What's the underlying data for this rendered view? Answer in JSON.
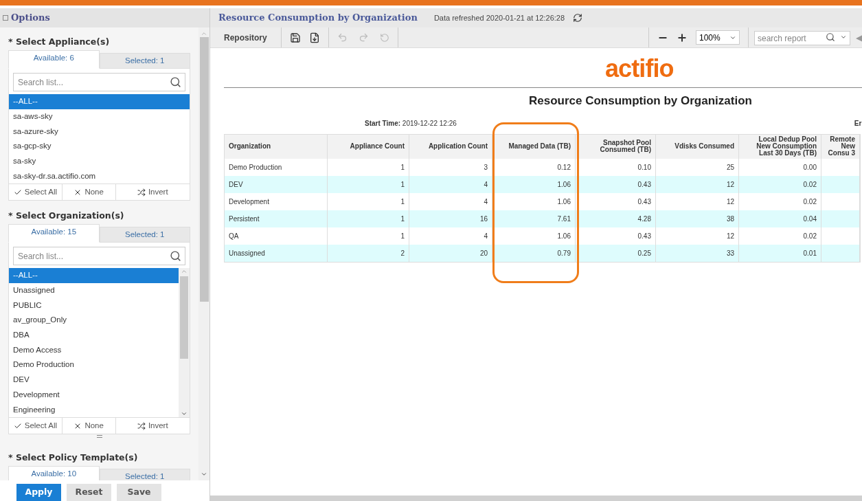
{
  "options_panel": {
    "title": "Options",
    "sections": [
      {
        "label": "* Select Appliance(s)",
        "tabs": [
          {
            "label": "Available: 6",
            "selected": true
          },
          {
            "label": "Selected: 1",
            "selected": false
          }
        ],
        "search_placeholder": "Search list...",
        "scrollable": false,
        "items": [
          {
            "label": "--ALL--",
            "selected": true
          },
          {
            "label": "sa-aws-sky",
            "selected": false
          },
          {
            "label": "sa-azure-sky",
            "selected": false
          },
          {
            "label": "sa-gcp-sky",
            "selected": false
          },
          {
            "label": "sa-sky",
            "selected": false
          },
          {
            "label": "sa-sky-dr.sa.actifio.com",
            "selected": false
          }
        ],
        "actions": [
          "Select All",
          "None",
          "Invert"
        ]
      },
      {
        "label": "* Select Organization(s)",
        "tabs": [
          {
            "label": "Available: 15",
            "selected": true
          },
          {
            "label": "Selected: 1",
            "selected": false
          }
        ],
        "search_placeholder": "Search list...",
        "scrollable": true,
        "items": [
          {
            "label": "--ALL--",
            "selected": true
          },
          {
            "label": "Unassigned",
            "selected": false
          },
          {
            "label": "PUBLIC",
            "selected": false
          },
          {
            "label": "av_group_Only",
            "selected": false
          },
          {
            "label": "DBA",
            "selected": false
          },
          {
            "label": "Demo Access",
            "selected": false
          },
          {
            "label": "Demo Production",
            "selected": false
          },
          {
            "label": "DEV",
            "selected": false
          },
          {
            "label": "Development",
            "selected": false
          },
          {
            "label": "Engineering",
            "selected": false
          }
        ],
        "actions": [
          "Select All",
          "None",
          "Invert"
        ]
      },
      {
        "label": "* Select Policy Template(s)",
        "tabs": [
          {
            "label": "Available: 10",
            "selected": true
          },
          {
            "label": "Selected: 1",
            "selected": false
          }
        ]
      }
    ],
    "buttons": [
      {
        "label": "Apply",
        "primary": true
      },
      {
        "label": "Reset",
        "primary": false
      },
      {
        "label": "Save",
        "primary": false
      }
    ]
  },
  "report_header": {
    "title": "Resource Consumption by Organization",
    "refreshed": "Data refreshed 2020-01-21 at 12:26:28"
  },
  "toolbar": {
    "repository": "Repository",
    "zoom": "100%",
    "search_placeholder": "search report",
    "collapse_glyph": "◀"
  },
  "report": {
    "logo": "actifio",
    "title": "Resource Consumption by Organization",
    "start_time_label": "Start Time:",
    "start_time": "2019-12-22 12:26",
    "end_time_label": "Er",
    "columns": [
      {
        "label": "Organization",
        "highlighted": false
      },
      {
        "label": "Appliance Count",
        "highlighted": false
      },
      {
        "label": "Application Count",
        "highlighted": false
      },
      {
        "label": "Managed Data (TB)",
        "highlighted": true
      },
      {
        "label": "Snapshot Pool Consumed (TB)",
        "highlighted": false
      },
      {
        "label": "Vdisks Consumed",
        "highlighted": false
      },
      {
        "label": "Local Dedup Pool New Consumption Last 30 Days (TB)",
        "highlighted": false
      },
      {
        "label": "Remote New Consu 3",
        "highlighted": false
      }
    ],
    "rows": [
      [
        "Demo Production",
        "1",
        "3",
        "0.12",
        "0.10",
        "25",
        "0.00"
      ],
      [
        "DEV",
        "1",
        "4",
        "1.06",
        "0.43",
        "12",
        "0.02"
      ],
      [
        "Development",
        "1",
        "4",
        "1.06",
        "0.43",
        "12",
        "0.02"
      ],
      [
        "Persistent",
        "1",
        "16",
        "7.61",
        "4.28",
        "38",
        "0.04"
      ],
      [
        "QA",
        "1",
        "4",
        "1.06",
        "0.43",
        "12",
        "0.02"
      ],
      [
        "Unassigned",
        "2",
        "20",
        "0.79",
        "0.25",
        "33",
        "0.01"
      ]
    ]
  }
}
